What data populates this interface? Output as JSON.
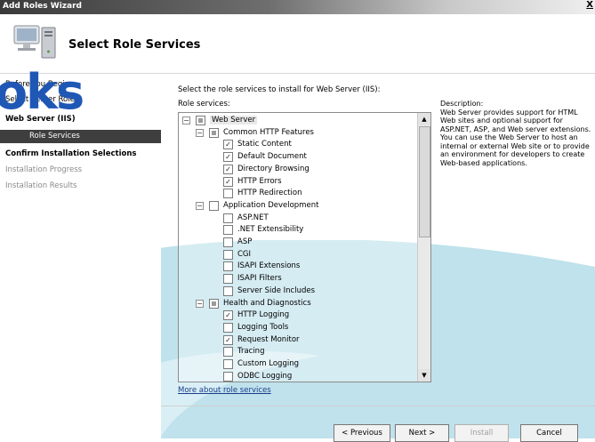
{
  "window": {
    "title": "Add Roles Wizard",
    "close": "X"
  },
  "header": {
    "heading": "Select Role Services",
    "icon": "wizard-computer-icon"
  },
  "watermark": "oks",
  "nav": {
    "items": [
      {
        "label": "Before You Begin",
        "state": "normal"
      },
      {
        "label": "Select Server Roles",
        "state": "normal"
      },
      {
        "label": "Web Server (IIS)",
        "state": "bold"
      },
      {
        "label": "Role Services",
        "state": "selected"
      },
      {
        "label": "Confirm Installation Selections",
        "state": "bold"
      },
      {
        "label": "Installation Progress",
        "state": "dim"
      },
      {
        "label": "Installation Results",
        "state": "dim"
      }
    ]
  },
  "main": {
    "instruction": "Select the role services to install for Web Server (IIS):",
    "tree_label": "Role services:",
    "tree": [
      {
        "label": "Web Server",
        "level": 0,
        "expander": "-",
        "check": "partial"
      },
      {
        "label": "Common HTTP Features",
        "level": 1,
        "expander": "-",
        "check": "partial"
      },
      {
        "label": "Static Content",
        "level": 2,
        "check": "checked"
      },
      {
        "label": "Default Document",
        "level": 2,
        "check": "checked"
      },
      {
        "label": "Directory Browsing",
        "level": 2,
        "check": "checked"
      },
      {
        "label": "HTTP Errors",
        "level": 2,
        "check": "checked"
      },
      {
        "label": "HTTP Redirection",
        "level": 2,
        "check": "unchecked"
      },
      {
        "label": "Application Development",
        "level": 1,
        "expander": "-",
        "check": "unchecked"
      },
      {
        "label": "ASP.NET",
        "level": 2,
        "check": "unchecked"
      },
      {
        "label": ".NET Extensibility",
        "level": 2,
        "check": "unchecked"
      },
      {
        "label": "ASP",
        "level": 2,
        "check": "unchecked"
      },
      {
        "label": "CGI",
        "level": 2,
        "check": "unchecked"
      },
      {
        "label": "ISAPI Extensions",
        "level": 2,
        "check": "unchecked"
      },
      {
        "label": "ISAPI Filters",
        "level": 2,
        "check": "unchecked"
      },
      {
        "label": "Server Side Includes",
        "level": 2,
        "check": "unchecked"
      },
      {
        "label": "Health and Diagnostics",
        "level": 1,
        "expander": "-",
        "check": "partial"
      },
      {
        "label": "HTTP Logging",
        "level": 2,
        "check": "checked"
      },
      {
        "label": "Logging Tools",
        "level": 2,
        "check": "unchecked"
      },
      {
        "label": "Request Monitor",
        "level": 2,
        "check": "checked"
      },
      {
        "label": "Tracing",
        "level": 2,
        "check": "unchecked"
      },
      {
        "label": "Custom Logging",
        "level": 2,
        "check": "unchecked"
      },
      {
        "label": "ODBC Logging",
        "level": 2,
        "check": "unchecked"
      }
    ],
    "description_title": "Description:",
    "description_body": "Web Server provides support for HTML Web sites and optional support for ASP.NET, ASP, and Web server extensions. You can use the Web Server to host an internal or external Web site or to provide an environment for developers to create Web-based applications.",
    "more_link": "More about role services"
  },
  "buttons": {
    "previous": "< Previous",
    "next": "Next >",
    "install": "Install",
    "cancel": "Cancel"
  },
  "colors": {
    "watermark": "#1f57b5",
    "swoosh": "#bfe2ec",
    "nav_selected": "#3e3e3e",
    "link": "#1a3c8c"
  }
}
